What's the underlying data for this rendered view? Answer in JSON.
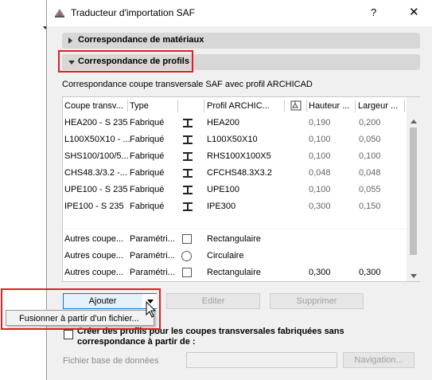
{
  "window": {
    "title": "Traducteur d'importation SAF",
    "help_label": "?",
    "close_label": "✕"
  },
  "sections": {
    "materials": "Correspondance de matériaux",
    "profiles": "Correspondance de profils"
  },
  "profiles": {
    "subtitle": "Correspondance coupe transversale SAF avec profil ARCHICAD",
    "columns": [
      "Coupe transv...",
      "Type",
      "",
      "Profil ARCHIC...",
      "",
      "Hauteur ...",
      "Largeur ..."
    ],
    "rows": [
      {
        "coupe": "HEA200 - S 235",
        "type": "Fabriqué",
        "icon": "i-beam-icon",
        "profil": "HEA200",
        "hauteur": "0,190",
        "largeur": "0,200"
      },
      {
        "coupe": "L100X50X10 - ...",
        "type": "Fabriqué",
        "icon": "i-beam-icon",
        "profil": "L100X50X10",
        "hauteur": "0,100",
        "largeur": "0,050"
      },
      {
        "coupe": "SHS100/100/5...",
        "type": "Fabriqué",
        "icon": "i-beam-icon",
        "profil": "RHS100X100X5",
        "hauteur": "0,100",
        "largeur": "0,100"
      },
      {
        "coupe": "CHS48.3/3.2 -...",
        "type": "Fabriqué",
        "icon": "i-beam-icon",
        "profil": "CFCHS48.3X3.2",
        "hauteur": "0,048",
        "largeur": "0,048"
      },
      {
        "coupe": "UPE100 - S 235",
        "type": "Fabriqué",
        "icon": "i-beam-icon",
        "profil": "UPE100",
        "hauteur": "0,100",
        "largeur": "0,055"
      },
      {
        "coupe": "IPE100 - S 235",
        "type": "Fabriqué",
        "icon": "i-beam-icon",
        "profil": "IPE300",
        "hauteur": "0,300",
        "largeur": "0,150"
      }
    ],
    "param_rows": [
      {
        "coupe": "Autres coupe...",
        "type": "Paramétri...",
        "icon": "square-icon",
        "profil": "Rectangulaire",
        "hauteur": "",
        "largeur": ""
      },
      {
        "coupe": "Autres coupe...",
        "type": "Paramétri...",
        "icon": "circle-icon",
        "profil": "Circulaire",
        "hauteur": "",
        "largeur": ""
      },
      {
        "coupe": "Autres coupe...",
        "type": "Paramétri...",
        "icon": "square-icon",
        "profil": "Rectangulaire",
        "hauteur": "0,300",
        "largeur": "0,300"
      }
    ]
  },
  "buttons": {
    "add": "Ajouter",
    "edit": "Editer",
    "delete": "Supprimer",
    "browse": "Navigation..."
  },
  "popup": {
    "merge_from_file": "Fusionner à partir d'un fichier..."
  },
  "create_profiles": {
    "label": "Créer des profils pour les coupes transversales fabriquées sans correspondance à partir de :",
    "checked": false
  },
  "database": {
    "label": "Fichier base de données",
    "value": ""
  },
  "colors": {
    "highlight": "#e02020",
    "section_bar": "#d7d7d7"
  }
}
